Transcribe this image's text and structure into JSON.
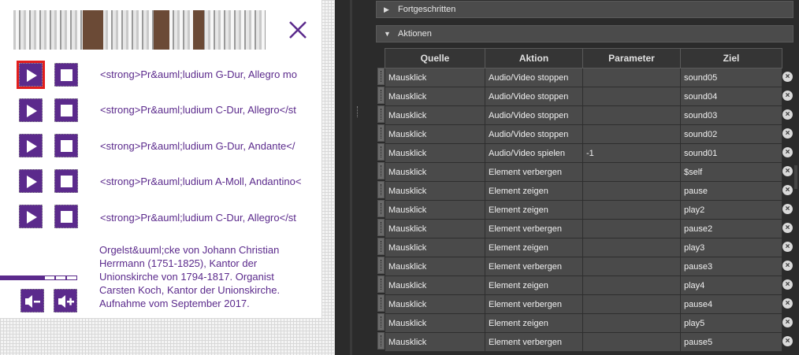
{
  "player": {
    "tracks": [
      {
        "label": "<strong>Pr&auml;ludium G-Dur, Allegro mo"
      },
      {
        "label": "<strong>Pr&auml;ludium C-Dur, Allegro</st"
      },
      {
        "label": "<strong>Pr&auml;ludium G-Dur, Andante</"
      },
      {
        "label": "<strong>Pr&auml;ludium A-Moll, Andantino<"
      },
      {
        "label": "<strong>Pr&auml;ludium C-Dur, Allegro</st"
      }
    ],
    "description": "Orgelst&uuml;cke von Johann Christian Herrmann (1751-1825), Kantor der Unionskirche von 1794-1817. Organist Carsten Koch, Kantor der Unionskirche. Aufnahme vom September 2017.",
    "volume_level": 0.58,
    "icons": {
      "play": "play-icon",
      "stop": "stop-icon",
      "close": "close-icon",
      "volume_down": "volume-down-icon",
      "volume_up": "volume-up-icon"
    },
    "accent_color": "#5b2a8c"
  },
  "panel": {
    "sections": [
      {
        "label": "Fortgeschritten",
        "expanded": false
      },
      {
        "label": "Aktionen",
        "expanded": true
      }
    ],
    "columns": [
      "Quelle",
      "Aktion",
      "Parameter",
      "Ziel"
    ],
    "rows": [
      {
        "quelle": "Mausklick",
        "aktion": "Audio/Video stoppen",
        "parameter": "",
        "ziel": "sound05"
      },
      {
        "quelle": "Mausklick",
        "aktion": "Audio/Video stoppen",
        "parameter": "",
        "ziel": "sound04"
      },
      {
        "quelle": "Mausklick",
        "aktion": "Audio/Video stoppen",
        "parameter": "",
        "ziel": "sound03"
      },
      {
        "quelle": "Mausklick",
        "aktion": "Audio/Video stoppen",
        "parameter": "",
        "ziel": "sound02"
      },
      {
        "quelle": "Mausklick",
        "aktion": "Audio/Video spielen",
        "parameter": "-1",
        "ziel": "sound01"
      },
      {
        "quelle": "Mausklick",
        "aktion": "Element verbergen",
        "parameter": "",
        "ziel": "$self"
      },
      {
        "quelle": "Mausklick",
        "aktion": "Element zeigen",
        "parameter": "",
        "ziel": "pause"
      },
      {
        "quelle": "Mausklick",
        "aktion": "Element zeigen",
        "parameter": "",
        "ziel": "play2"
      },
      {
        "quelle": "Mausklick",
        "aktion": "Element verbergen",
        "parameter": "",
        "ziel": "pause2"
      },
      {
        "quelle": "Mausklick",
        "aktion": "Element zeigen",
        "parameter": "",
        "ziel": "play3"
      },
      {
        "quelle": "Mausklick",
        "aktion": "Element verbergen",
        "parameter": "",
        "ziel": "pause3"
      },
      {
        "quelle": "Mausklick",
        "aktion": "Element zeigen",
        "parameter": "",
        "ziel": "play4"
      },
      {
        "quelle": "Mausklick",
        "aktion": "Element verbergen",
        "parameter": "",
        "ziel": "pause4"
      },
      {
        "quelle": "Mausklick",
        "aktion": "Element zeigen",
        "parameter": "",
        "ziel": "play5"
      },
      {
        "quelle": "Mausklick",
        "aktion": "Element verbergen",
        "parameter": "",
        "ziel": "pause5"
      }
    ]
  }
}
